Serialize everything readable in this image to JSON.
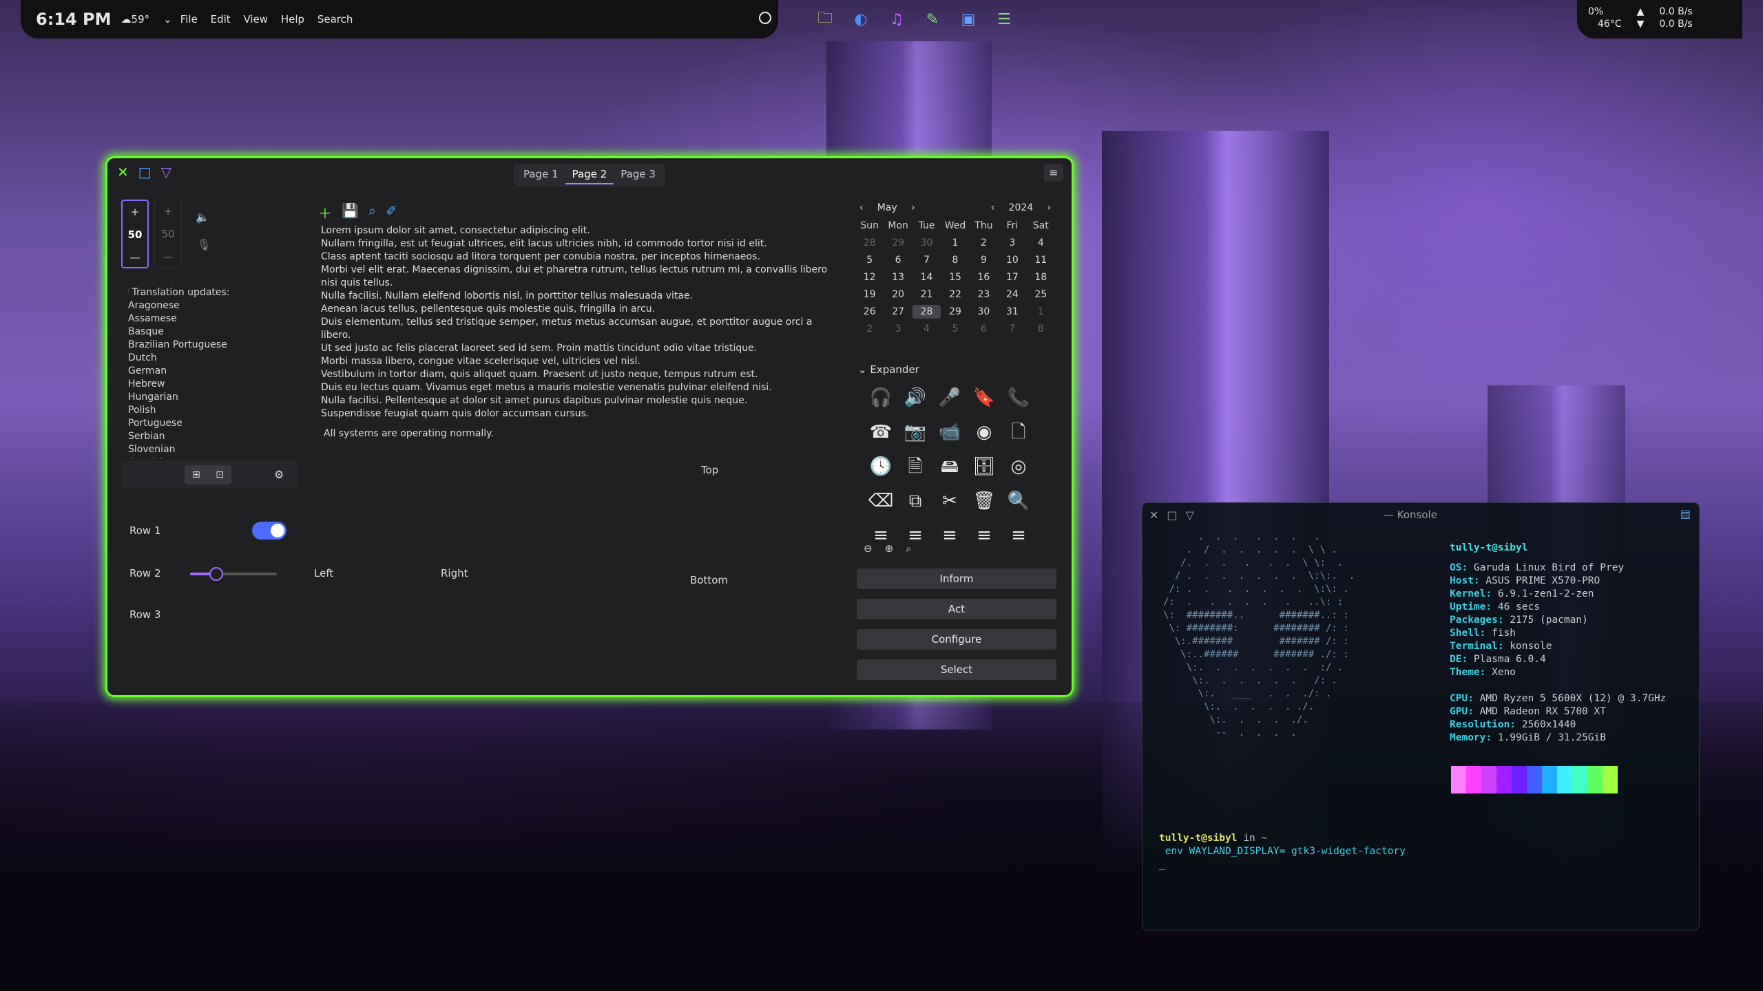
{
  "panel": {
    "clock": "6:14 PM",
    "weather": "59°",
    "menu": [
      "File",
      "Edit",
      "View",
      "Help",
      "Search"
    ]
  },
  "tray": {
    "cpu": "0%",
    "cpu_temp": "46°C",
    "net_up": "0.0 B/s",
    "net_down": "0.0 B/s"
  },
  "gtk": {
    "tabs": [
      "Page 1",
      "Page 2",
      "Page 3"
    ],
    "active_tab": "Page 2",
    "spin1": {
      "plus": "+",
      "value": "50",
      "minus": "—"
    },
    "spin2": {
      "plus": "+",
      "value": "50",
      "minus": "—"
    },
    "translation_header": "* Translation updates:",
    "languages": [
      "Aragonese",
      "Assamese",
      "Basque",
      "Brazilian Portuguese",
      "Dutch",
      "German",
      "Hebrew",
      "Hungarian",
      "Polish",
      "Portuguese",
      "Serbian",
      "Slovenian",
      "Spanish"
    ],
    "rows": {
      "row1": "Row 1",
      "row2": "Row 2",
      "row3": "Row 3"
    },
    "slider_value": 0.3,
    "labels": {
      "left": "Left",
      "right": "Right",
      "top": "Top",
      "bottom": "Bottom"
    },
    "lorem": [
      "Lorem ipsum dolor sit amet, consectetur adipiscing elit.",
      "Nullam fringilla, est ut feugiat ultrices, elit lacus ultricies nibh, id commodo tortor nisi id elit.",
      "Class aptent taciti sociosqu ad litora torquent per conubia nostra, per inceptos himenaeos.",
      "Morbi vel elit erat. Maecenas dignissim, dui et pharetra rutrum, tellus lectus rutrum mi, a convallis libero nisi quis tellus.",
      "Nulla facilisi. Nullam eleifend lobortis nisl, in porttitor tellus malesuada vitae.",
      "Aenean lacus tellus, pellentesque quis molestie quis, fringilla in arcu.",
      "Duis elementum, tellus sed tristique semper, metus metus accumsan augue, et porttitor augue orci a libero.",
      "Ut sed justo ac felis placerat laoreet sed id sem. Proin mattis tincidunt odio vitae tristique.",
      "Morbi massa libero, congue vitae scelerisque vel, ultricies vel nisl.",
      "Vestibulum in tortor diam, quis aliquet quam. Praesent ut justo neque, tempus rutrum est.",
      "Duis eu lectus quam. Vivamus eget metus a mauris molestie venenatis pulvinar eleifend nisi.",
      "Nulla facilisi. Pellentesque at dolor sit amet purus dapibus pulvinar molestie quis neque.",
      "Suspendisse feugiat quam quis dolor accumsan cursus."
    ],
    "status": "All systems are operating normally.",
    "calendar": {
      "month": "May",
      "year": "2024",
      "weekdays": [
        "Sun",
        "Mon",
        "Tue",
        "Wed",
        "Thu",
        "Fri",
        "Sat"
      ],
      "days": [
        "28",
        "29",
        "30",
        "1",
        "2",
        "3",
        "4",
        "5",
        "6",
        "7",
        "8",
        "9",
        "10",
        "11",
        "12",
        "13",
        "14",
        "15",
        "16",
        "17",
        "18",
        "19",
        "20",
        "21",
        "22",
        "23",
        "24",
        "25",
        "26",
        "27",
        "28",
        "29",
        "30",
        "31",
        "1",
        "2",
        "3",
        "4",
        "5",
        "6",
        "7",
        "8"
      ],
      "selected_index": 30
    },
    "expander": "Expander",
    "buttons": [
      "Inform",
      "Act",
      "Configure",
      "Select"
    ]
  },
  "konsole": {
    "title": "— Konsole",
    "user_host": "tully-t@sibyl",
    "info": [
      {
        "k": "OS",
        "v": "Garuda Linux Bird of Prey"
      },
      {
        "k": "Host",
        "v": "ASUS PRIME X570-PRO"
      },
      {
        "k": "Kernel",
        "v": "6.9.1-zen1-2-zen"
      },
      {
        "k": "Uptime",
        "v": "46 secs"
      },
      {
        "k": "Packages",
        "v": "2175 (pacman)"
      },
      {
        "k": "Shell",
        "v": "fish"
      },
      {
        "k": "Terminal",
        "v": "konsole"
      },
      {
        "k": "DE",
        "v": "Plasma 6.0.4"
      },
      {
        "k": "Theme",
        "v": "Xeno"
      },
      {
        "k": "CPU",
        "v": "AMD Ryzen 5 5600X (12) @ 3.7GHz"
      },
      {
        "k": "GPU",
        "v": "AMD Radeon RX 5700 XT"
      },
      {
        "k": "Resolution",
        "v": "2560x1440"
      },
      {
        "k": "Memory",
        "v": "1.99GiB / 31.25GiB"
      }
    ],
    "swatches": [
      "#ff80ff",
      "#ff40ff",
      "#d040ff",
      "#a020ff",
      "#6a20ff",
      "#4060ff",
      "#20b0ff",
      "#40f0ff",
      "#40ffc0",
      "#60ff60",
      "#a0ff40"
    ],
    "prompt_user": "tully-t@sibyl",
    "prompt_dir": "in ~",
    "command": "env WAYLAND_DISPLAY= gtk3-widget-factory",
    "cursor": "_"
  }
}
